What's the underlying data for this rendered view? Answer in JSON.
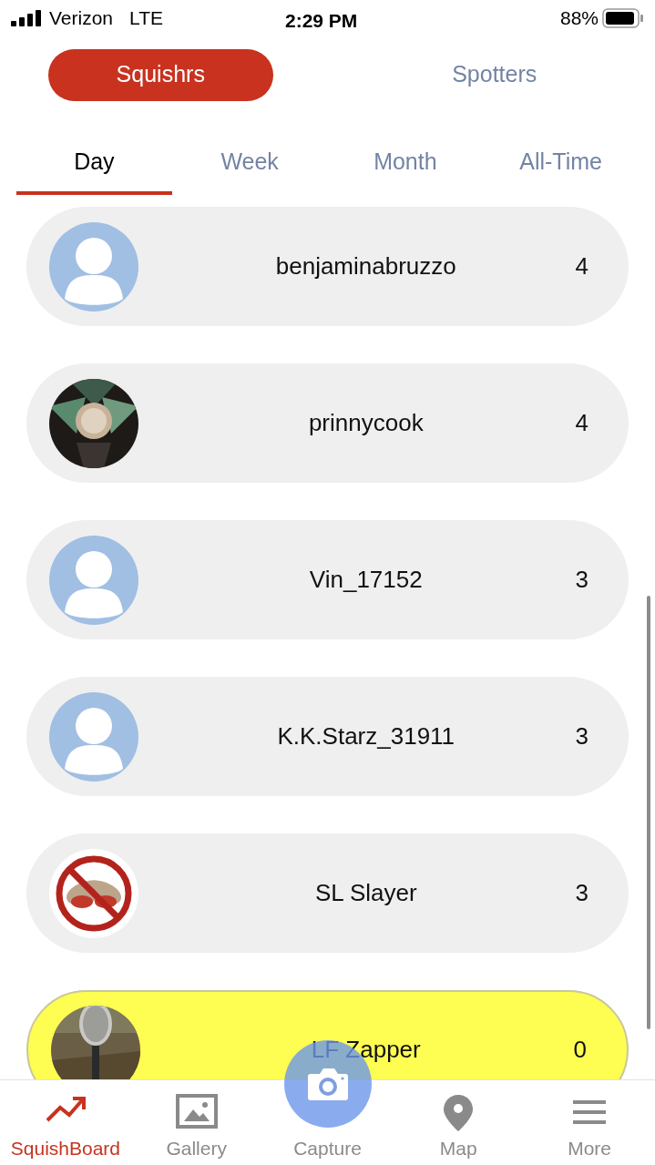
{
  "status_bar": {
    "carrier": "Verizon",
    "network": "LTE",
    "time": "2:29 PM",
    "battery": "88%"
  },
  "segments": [
    {
      "label": "Squishrs",
      "selected": true
    },
    {
      "label": "Spotters",
      "selected": false
    }
  ],
  "tabs": [
    {
      "label": "Day",
      "selected": true
    },
    {
      "label": "Week",
      "selected": false
    },
    {
      "label": "Month",
      "selected": false
    },
    {
      "label": "All-Time",
      "selected": false
    }
  ],
  "leaderboard": [
    {
      "kind": "default",
      "name": "benjaminabruzzo",
      "count": "4",
      "highlighted": false
    },
    {
      "kind": "picture",
      "name": "prinnycook",
      "count": "4",
      "highlighted": false
    },
    {
      "kind": "default",
      "name": "Vin_17152",
      "count": "3",
      "highlighted": false
    },
    {
      "kind": "default",
      "name": "K.K.Starz_31911",
      "count": "3",
      "highlighted": false
    },
    {
      "kind": "picture",
      "name": "SL Slayer",
      "count": "3",
      "highlighted": false
    },
    {
      "kind": "picture",
      "name": "LF Zapper",
      "count": "0",
      "highlighted": true
    }
  ],
  "bottom_nav": [
    {
      "kind": "chart",
      "label": "SquishBoard",
      "selected": true
    },
    {
      "label": "Gallery",
      "selected": false
    },
    {
      "kind": "camera",
      "label": "Capture",
      "selected": false
    },
    {
      "kind": "pin",
      "label": "Map",
      "selected": false
    },
    {
      "kind": "menu",
      "label": "More",
      "selected": false
    }
  ]
}
